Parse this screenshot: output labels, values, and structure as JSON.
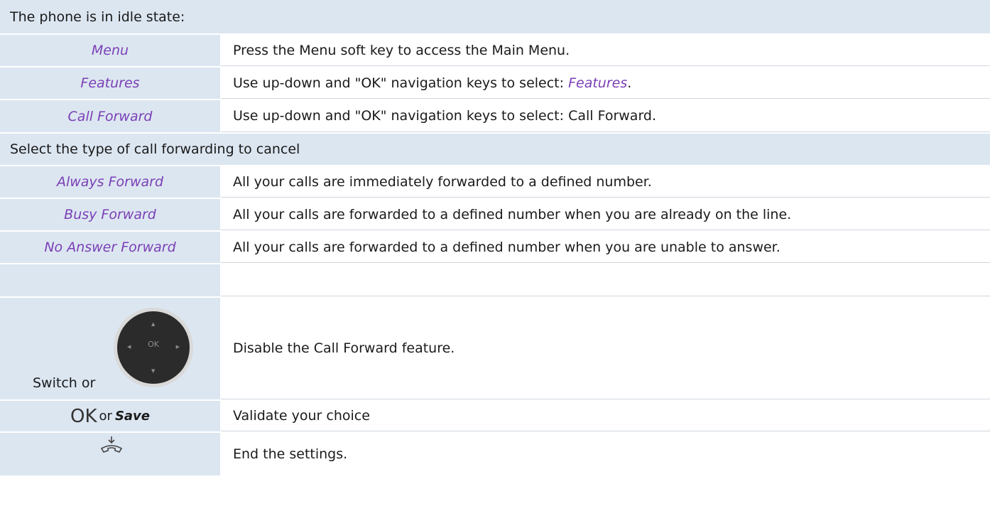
{
  "rows": {
    "header1": "The phone is in idle state:",
    "menu": {
      "left": "Menu",
      "right": "Press the Menu soft key to access the Main Menu."
    },
    "features": {
      "left": "Features",
      "right_prefix": "Use up-down and \"OK\" navigation keys to select: ",
      "right_em": "Features",
      "right_suffix": "."
    },
    "callforward": {
      "left": "Call Forward",
      "right": "Use up-down and \"OK\" navigation keys to select: Call Forward."
    },
    "header2": "Select the type of call forwarding to cancel",
    "always": {
      "left": "Always Forward",
      "right": "All your calls are immediately forwarded to a defined number."
    },
    "busy": {
      "left": "Busy Forward",
      "right": "All your calls are forwarded to a defined number when you are already on the line."
    },
    "noanswer": {
      "left": "No Answer Forward",
      "right": "All your calls are forwarded to a defined number when you are unable to answer."
    },
    "switch": {
      "left": "Switch or",
      "nav_ok": "OK",
      "right": "Disable the Call Forward feature."
    },
    "validate": {
      "ok": "OK",
      "or": "or",
      "save": "Save",
      "right": "Validate your choice"
    },
    "end": {
      "right": "End the settings."
    }
  },
  "colors": {
    "row_bg": "#dce6f1",
    "accent_purple": "#7a3fb5"
  },
  "icons": [
    "navigation-pad-icon",
    "hang-up-icon"
  ]
}
